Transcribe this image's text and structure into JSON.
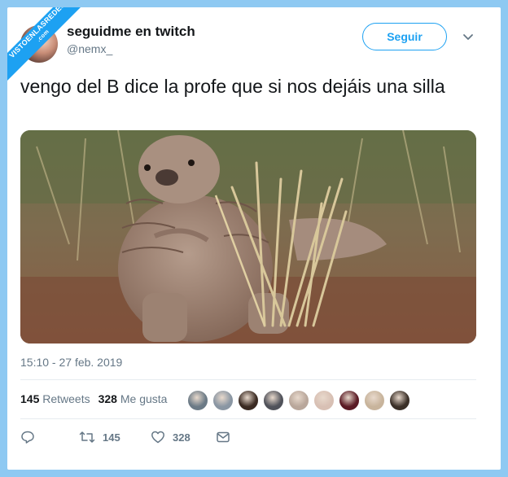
{
  "watermark": {
    "line1": "VISTOENLASREDES",
    "line2": ".com"
  },
  "tweet": {
    "display_name": "seguidme en twitch",
    "handle": "@nemx_",
    "follow_label": "Seguir",
    "text": "vengo del B dice la profe que si nos dejáis una silla",
    "timestamp": "15:10 - 27 feb. 2019",
    "retweets_count": "145",
    "retweets_label": "Retweets",
    "likes_count": "328",
    "likes_label": "Me gusta",
    "action_retweets": "145",
    "action_likes": "328"
  },
  "colors": {
    "accent": "#1da1f2",
    "background": "#8ec9f2",
    "muted_text": "#657786",
    "text": "#14171a"
  },
  "icons": [
    "chevron-down-icon",
    "reply-icon",
    "retweet-icon",
    "heart-icon",
    "message-icon"
  ],
  "photo": {
    "subject": "pangolin"
  },
  "liker_avatars": [
    {
      "color": "#6b7a86"
    },
    {
      "color": "#8a96a3"
    },
    {
      "color": "#3a2a22"
    },
    {
      "color": "#50525a"
    },
    {
      "color": "#b9a79b"
    },
    {
      "color": "#d8c0b4"
    },
    {
      "color": "#5a1a24"
    },
    {
      "color": "#c8b49c"
    },
    {
      "color": "#3b3028"
    }
  ]
}
